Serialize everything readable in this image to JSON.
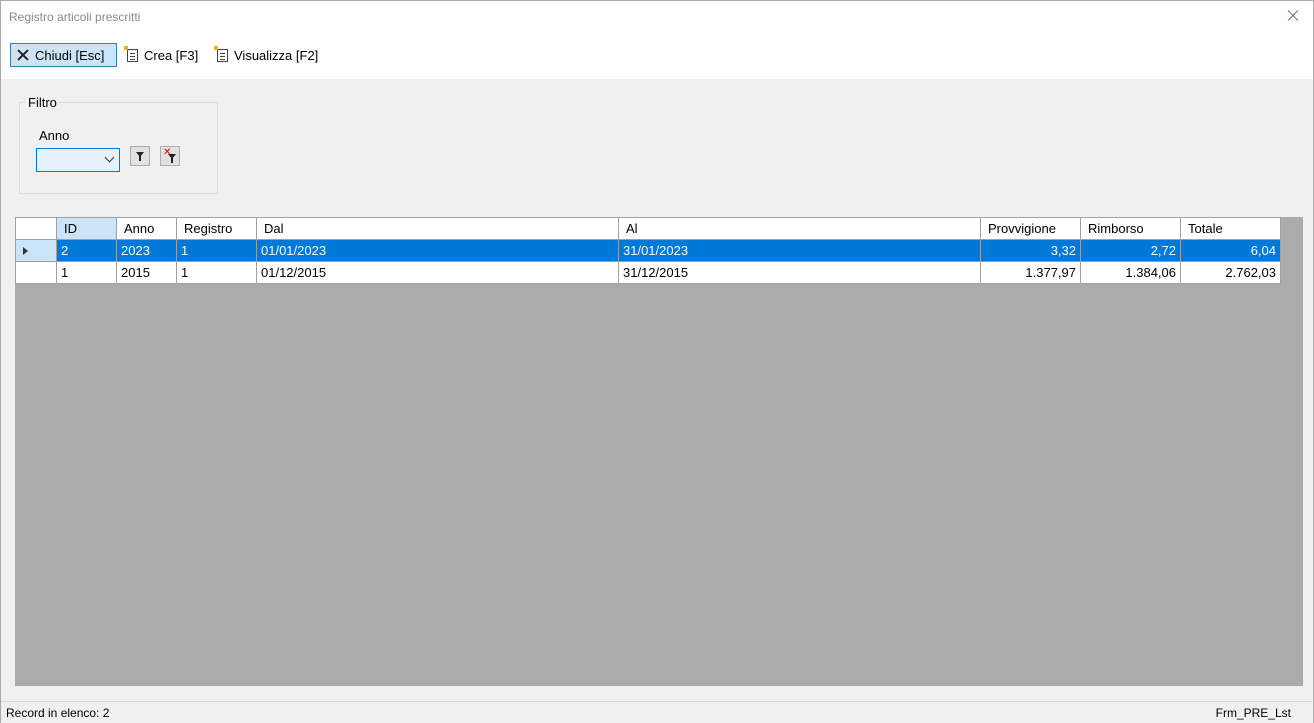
{
  "window": {
    "title": "Registro articoli prescritti"
  },
  "toolbar": {
    "close_label": "Chiudi [Esc]",
    "create_label": "Crea [F3]",
    "view_label": "Visualizza [F2]"
  },
  "filter": {
    "legend": "Filtro",
    "year_label": "Anno",
    "year_value": ""
  },
  "grid": {
    "columns": [
      "ID",
      "Anno",
      "Registro",
      "Dal",
      "Al",
      "Provvigione",
      "Rimborso",
      "Totale"
    ],
    "rows": [
      [
        "2",
        "2023",
        "1",
        "01/01/2023",
        "31/01/2023",
        "3,32",
        "2,72",
        "6,04"
      ],
      [
        "1",
        "2015",
        "1",
        "01/12/2015",
        "31/12/2015",
        "1.377,97",
        "1.384,06",
        "2.762,03"
      ]
    ],
    "selected_row": 0
  },
  "status": {
    "record_count": "Record in elenco: 2",
    "form_name": "Frm_PRE_Lst"
  },
  "colors": {
    "selection": "#0078d7",
    "header_selected": "#cce4f7",
    "grid_background": "#ababab"
  }
}
